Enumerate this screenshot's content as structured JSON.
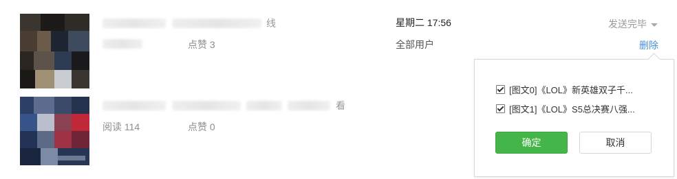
{
  "articles": [
    {
      "title_tail": "线",
      "date": "星期二 17:56",
      "likes_label": "点赞 3",
      "audience": "全部用户",
      "status": "发送完毕",
      "delete_label": "删除"
    },
    {
      "title_tail": "看",
      "reads_label": "阅读 114",
      "likes_label": "点赞 0"
    }
  ],
  "popover": {
    "options": [
      {
        "label": "[图文0]《LOL》新英雄双子千...",
        "checked": true
      },
      {
        "label": "[图文1]《LOL》S5总决赛八强...",
        "checked": true
      }
    ],
    "confirm_label": "确定",
    "cancel_label": "取消"
  },
  "colors": {
    "confirm": "#44b549",
    "link": "#4a90d6"
  },
  "icons": [
    "chevron-down-icon",
    "checkbox-checked-icon"
  ]
}
